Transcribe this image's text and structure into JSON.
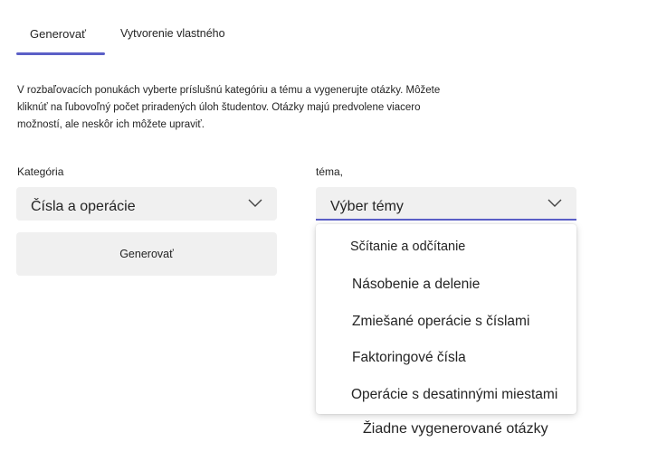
{
  "tabs": {
    "generate": "Generovať",
    "custom": "Vytvorenie vlastného"
  },
  "instructions": "V rozbaľovacích ponukách vyberte príslušnú kategóriu a tému a vygenerujte otázky. Môžete kliknúť na ľubovoľný počet priradených úloh študentov. Otázky majú predvolene viacero možností, ale neskôr ich môžete upraviť.",
  "category": {
    "label": "Kategória",
    "value": "Čísla a operácie"
  },
  "topic": {
    "label": "téma,",
    "placeholder": "Výber témy",
    "options": [
      "Sčítanie a odčítanie",
      "Násobenie a delenie",
      "Zmiešané operácie s číslami",
      "Faktoringové čísla",
      "Operácie s desatinnými miestami"
    ]
  },
  "generate_button": "Generovať",
  "empty_state": "Žiadne vygenerované otázky",
  "colors": {
    "accent": "#5b5fc7",
    "control_bg": "#f0f0f0"
  }
}
